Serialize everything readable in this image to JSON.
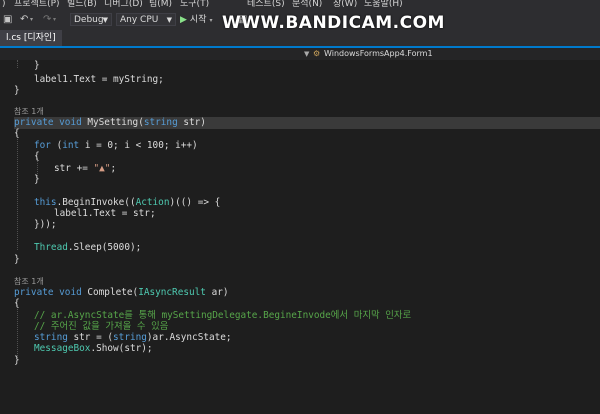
{
  "menubar": {
    "items": [
      ")",
      "프로젝트(P)",
      "빌드(B)",
      "디버그(D)",
      "팀(M)",
      "도구(T)",
      "테스트(S)",
      "분석(N)",
      "창(W)",
      "도움말(H)"
    ]
  },
  "toolbar": {
    "config": "Debug",
    "platform": "Any CPU",
    "start_label": "시작",
    "watermark": "WWW.BANDICAM.COM"
  },
  "tab": {
    "title": "l.cs [디자인]"
  },
  "navbar": {
    "location": "WindowsFormsApp4.Form1"
  },
  "colors": {
    "background": "#1e1e1e",
    "keyword": "#569cd6",
    "type": "#4ec9b0",
    "string": "#d69d85",
    "comment": "#57a64a",
    "accent": "#007acc"
  },
  "code": {
    "l00": "}",
    "l01a": "label1.Text = myString;",
    "l02": "}",
    "ref1": "참조 1개",
    "l03_kw": "private void",
    "l03_name": " MySetting",
    "l03_open": "(",
    "l03_pkw": "string",
    "l03_pname": " str",
    "l03_close": ")",
    "l04": "{",
    "l05_kw": "for",
    "l05_a": " (",
    "l05_int": "int",
    "l05_b": " i = 0; i < 100; i++)",
    "l06": "{",
    "l07_a": "str += ",
    "l07_str": "\"▲\"",
    "l07_b": ";",
    "l08": "}",
    "l09_kw": "this",
    "l09_a": ".BeginInvoke((",
    "l09_ty": "Action",
    "l09_b": ")(() => {",
    "l10": "label1.Text = str;",
    "l11": "}));",
    "l12_ty": "Thread",
    "l12_a": ".Sleep(5000);",
    "l13": "}",
    "ref2": "참조 1개",
    "l14_kw": "private void",
    "l14_a": " Complete(",
    "l14_ty": "IAsyncResult",
    "l14_b": " ar)",
    "l15": "{",
    "l16": "// ar.AsyncState를 통해 mySettingDelegate.BegineInvode에서 마지막 인자로",
    "l17": "// 주어진 값을 가져올 수 있음",
    "l18_kw": "string",
    "l18_a": " str = (",
    "l18_kw2": "string",
    "l18_b": ")ar.AsyncState;",
    "l19_ty": "MessageBox",
    "l19_a": ".Show(str);",
    "l20": "}"
  }
}
